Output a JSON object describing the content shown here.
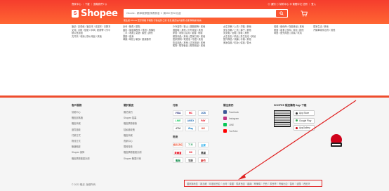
{
  "header": {
    "top_left": "賣家中心 ｜ 下載 ｜ 追蹤我們 f ◎",
    "top_right": "◎ 通知   ⓘ 幫助中心   ⊕ 繁體中文   註冊 ｜ 登入",
    "logo_text": "Shopee",
    "search_placeholder": "Clinelle - 精萃玻尿酸淨膚原液 ✦ 滿350 折50元起",
    "search_suggestions": "衛生紙   iPhone 藍牙耳機   手機殼   行動電源   口罩   包包   蝦皮站內優惠  衣服   購物袋   收納"
  },
  "categories": [
    {
      "lines": [
        "筆記 / 記錄紙 / 筆記本 / 素描本 / 日曆本",
        "文具 | 手帳 / 貼紙 / 印章 | 紙膠帶 / 打印",
        "辦公室用品",
        "文件夾 / 收納 | 辦公用品 / 其他"
      ]
    },
    {
      "lines": [
        "壽司 / 鰻魚 / 甜點",
        "攝影 / 攝影機配件 / 電池 / 相機包",
        "二手 / 收藏 | 桌遊 / 模型 | 其他",
        "",
        "運動 / 健身",
        "球類 / 球拍 | 瑜伽 / 健身器材"
      ]
    },
    {
      "lines": [
        "戶外露營 / 登山 | 運動服飾 / 其他",
        "運動鞋 / 其他 / 戶外用品 / 其他",
        "家居 / 收納 | 寢具 / 窗簾 / 地毯",
        "餐廚用品 / 其他 | 居家日用 / 其他",
        "居家照明 / 電燈泡 / 吊燈 / 其他",
        "衛浴用品 / 其他 | 清潔用品 / 其他",
        "寵物 / 寵物食品 | 寵物用品 / 其他",
        "",
        "",
        "",
        "",
        ""
      ]
    },
    {
      "lines": [
        "女生衣著 / 上衣 / 洋裝 / 其他",
        "男生衣著 / 上衣 / 褲子 / 其他",
        "男女鞋 / 女鞋 | 男鞋 / 其他",
        "女生包包 / 精品 | 男生包包 / 其他",
        "配件飾品 / 項鍊 | 手錶 / 其他",
        "美妝保養 / 彩妝 | 保養 / 香水",
        "",
        "",
        "",
        "",
        ""
      ]
    },
    {
      "lines": [
        "保健 / 維他命 / 保健食品 | 其他",
        "美食 / 零食 | 飲料 / 沖泡 | 其他",
        "母嬰 / 嬰兒用品 | 童裝 / 玩具",
        "",
        ""
      ]
    },
    {
      "lines": [
        "居家生活 / 其他",
        "",
        "",
        "汽機車零件百貨 / 其他"
      ]
    }
  ],
  "footer": {
    "col1": {
      "title": "客戶服務",
      "links": [
        "幫助中心",
        "蝦皮部落格",
        "蝦皮商城",
        "退貨退款",
        "付款方式",
        "物流方式",
        "聯絡蝦皮",
        "Shopee 保障",
        "蝦皮購物推廣計劃"
      ]
    },
    "col2": {
      "title": "關於蝦皮",
      "links": [
        "關於我們",
        "Shopee 招募",
        "蝦皮購物條款",
        "隱私權政策",
        "蝦皮商城",
        "賣家中心",
        "限時特賣",
        "蝦皮購物推廣計劃",
        "Shopee 聯盟行銷"
      ]
    },
    "payment": {
      "title": "付款",
      "items": [
        "VISA",
        "MC",
        "JCB",
        "LINE",
        "AMEX",
        "PAY",
        "ATM",
        "iPay",
        "KK"
      ]
    },
    "logistics": {
      "title": "物流",
      "items": [
        "蝦皮店到店",
        "7-11",
        "全家",
        "萊爾富",
        "OK",
        "黑貓",
        "郵局",
        "宅配",
        "新竹"
      ]
    },
    "social": {
      "title": "關注我們",
      "items": [
        "Facebook",
        "Instagram",
        "LINE",
        "YouTube"
      ]
    },
    "app": {
      "title": "SHOPEE 蝦皮購物 App 下載",
      "stores": [
        "App Store",
        "Google Play",
        "AppGallery"
      ]
    },
    "copyright": "© 2023 蝦皮. 版權所有.",
    "countries": [
      "國家與地區",
      "新加坡",
      "印度尼西亞",
      "台灣",
      "泰國",
      "馬來西亞",
      "越南",
      "菲律賓",
      "巴西",
      "墨西哥",
      "哥倫比亞",
      "智利",
      "波蘭",
      "西班牙"
    ]
  },
  "colors": {
    "brand": "#ee4d2d",
    "annotation": "#e02020"
  }
}
